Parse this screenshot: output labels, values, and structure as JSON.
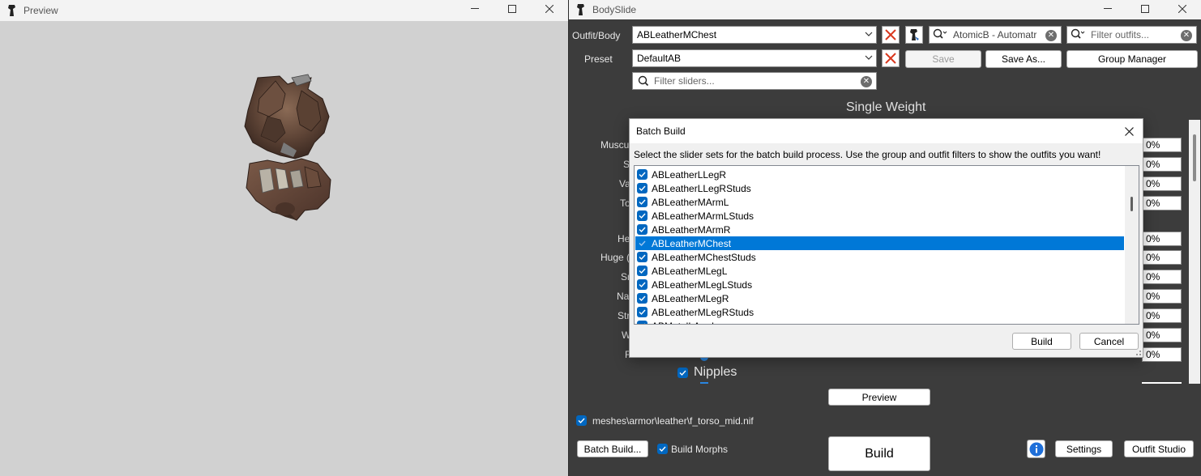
{
  "preview": {
    "title": "Preview"
  },
  "bodyslide": {
    "title": "BodySlide",
    "outfit_label": "Outfit/Body",
    "outfit_value": "ABLeatherMChest",
    "preset_label": "Preset",
    "preset_value": "DefaultAB",
    "group_filter_value": "AtomicB - Automatr",
    "outfit_filter_placeholder": "Filter outfits...",
    "slider_filter_placeholder": "Filter sliders...",
    "save_label": "Save",
    "save_as_label": "Save As...",
    "group_manager_label": "Group Manager",
    "weight_header": "Single Weight",
    "slider_labels": [
      "Muscu",
      "S",
      "Va",
      "To",
      "He",
      "Huge (",
      "Sr",
      "Na",
      "Str",
      "W",
      "Flat"
    ],
    "slider_values": [
      "0%",
      "0%",
      "0%",
      "0%",
      "0%",
      "0%",
      "0%",
      "0%",
      "0%",
      "0%",
      "0%"
    ],
    "nipples_label": "Nipples",
    "preview_button": "Preview",
    "mesh_path": "meshes\\armor\\leather\\f_torso_mid.nif",
    "batch_build_button": "Batch Build...",
    "build_morphs_label": "Build Morphs",
    "build_button": "Build",
    "info_icon": "info-icon",
    "settings_button": "Settings",
    "outfit_studio_button": "Outfit Studio"
  },
  "dialog": {
    "title": "Batch Build",
    "instructions": "Select the slider sets for the batch build process. Use the group and outfit filters to show the outfits you want!",
    "items": [
      "ABLeatherLLegR",
      "ABLeatherLLegRStuds",
      "ABLeatherMArmL",
      "ABLeatherMArmLStuds",
      "ABLeatherMArmR",
      "ABLeatherMChest",
      "ABLeatherMChestStuds",
      "ABLeatherMLegL",
      "ABLeatherMLegLStuds",
      "ABLeatherMLegR",
      "ABLeatherMLegRStuds",
      "ABMetalLArmL"
    ],
    "selected_index": 5,
    "build_label": "Build",
    "cancel_label": "Cancel"
  },
  "colors": {
    "accent": "#0067c0",
    "selection": "#0078d7",
    "bodyslide_bg": "#3c3c3c",
    "preview_bg": "#d1d1d1",
    "clear_button_red": "#d9381e"
  }
}
